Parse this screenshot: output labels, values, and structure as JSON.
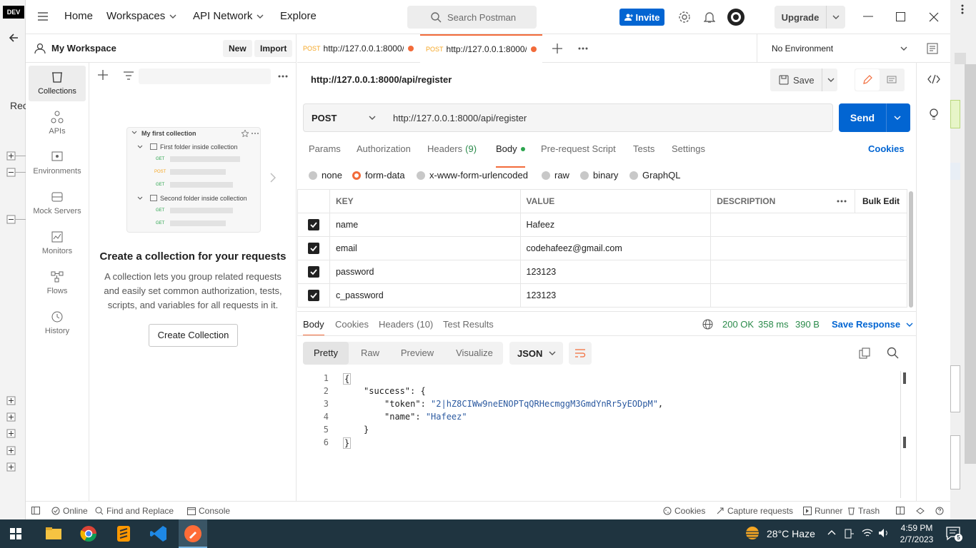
{
  "bg_left": {
    "logo": "DEV",
    "partial_text": "Rec"
  },
  "header": {
    "nav": [
      "Home",
      "Workspaces",
      "API Network",
      "Explore"
    ],
    "search_placeholder": "Search Postman",
    "invite_label": "Invite",
    "upgrade_label": "Upgrade"
  },
  "workspace": {
    "name": "My Workspace",
    "new_label": "New",
    "import_label": "Import"
  },
  "rail": [
    "Collections",
    "APIs",
    "Environments",
    "Mock Servers",
    "Monitors",
    "Flows",
    "History"
  ],
  "illustration": {
    "collection": "My first collection",
    "folder1": "First folder inside collection",
    "folder2": "Second folder inside collection",
    "get": "GET",
    "post": "POST"
  },
  "empty": {
    "title": "Create a collection for your requests",
    "desc": "A collection lets you group related requests and easily set common authorization, tests, scripts, and variables for all requests in it.",
    "button": "Create Collection"
  },
  "tabs": [
    {
      "method": "POST",
      "url": "http://127.0.0.1:8000/a"
    },
    {
      "method": "POST",
      "url": "http://127.0.0.1:8000/a"
    }
  ],
  "environment": "No Environment",
  "request": {
    "title": "http://127.0.0.1:8000/api/register",
    "save_label": "Save",
    "method": "POST",
    "url": "http://127.0.0.1:8000/api/register",
    "send_label": "Send"
  },
  "req_tabs": [
    "Params",
    "Authorization",
    "Headers",
    "Body",
    "Pre-request Script",
    "Tests",
    "Settings"
  ],
  "headers_count": "(9)",
  "cookies_link": "Cookies",
  "body_types": [
    "none",
    "form-data",
    "x-www-form-urlencoded",
    "raw",
    "binary",
    "GraphQL"
  ],
  "table": {
    "headers": [
      "KEY",
      "VALUE",
      "DESCRIPTION"
    ],
    "bulk_edit": "Bulk Edit",
    "rows": [
      {
        "key": "name",
        "value": "Hafeez"
      },
      {
        "key": "email",
        "value": "codehafeez@gmail.com"
      },
      {
        "key": "password",
        "value": "123123"
      },
      {
        "key": "c_password",
        "value": "123123"
      }
    ]
  },
  "response": {
    "tabs": [
      "Body",
      "Cookies",
      "Headers",
      "Test Results"
    ],
    "headers_count": "(10)",
    "status": "200 OK",
    "time": "358 ms",
    "size": "390 B",
    "save_response": "Save Response",
    "views": [
      "Pretty",
      "Raw",
      "Preview",
      "Visualize"
    ],
    "format": "JSON",
    "lines": [
      "1",
      "2",
      "3",
      "4",
      "5",
      "6"
    ],
    "code": {
      "l1": "{",
      "l2k": "\"success\"",
      "l2v": ": {",
      "l3k": "\"token\"",
      "l3v": "\"2|hZ8CIWw9neENOPTqQRHecmggM3GmdYnRr5yEODpM\"",
      "l4k": "\"name\"",
      "l4v": "\"Hafeez\"",
      "l5": "}",
      "l6": "}"
    }
  },
  "statusbar": {
    "online": "Online",
    "find": "Find and Replace",
    "console": "Console",
    "cookies": "Cookies",
    "capture": "Capture requests",
    "runner": "Runner",
    "trash": "Trash"
  },
  "taskbar": {
    "weather": "28°C  Haze",
    "time": "4:59 PM",
    "date": "2/7/2023",
    "notif_count": "5"
  }
}
